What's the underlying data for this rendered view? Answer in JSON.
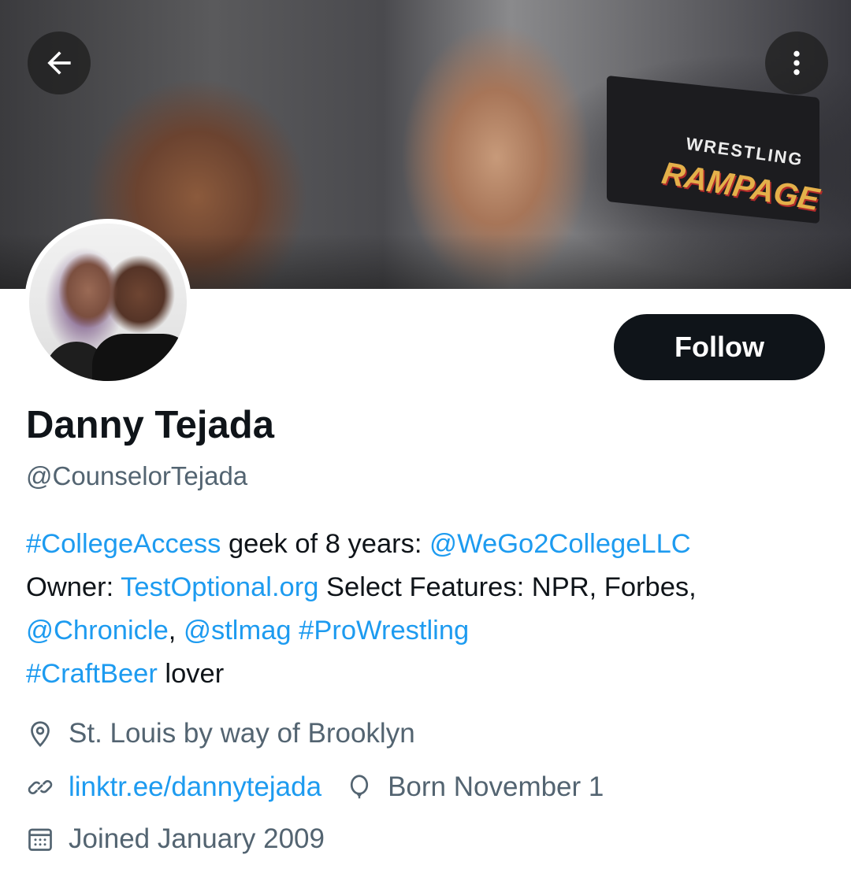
{
  "header": {
    "back_icon": "arrow-left-icon",
    "more_icon": "more-vertical-icon"
  },
  "banner": {
    "sign_line1": "WRESTLING",
    "sign_line2": "RAMPAGE"
  },
  "profile": {
    "display_name": "Danny Tejada",
    "handle": "@CounselorTejada",
    "follow_label": "Follow"
  },
  "bio": {
    "hashtag_college_access": "#CollegeAccess",
    "text_1": " geek of 8 years: ",
    "mention_wego": "@WeGo2CollegeLLC",
    "text_owner": "Owner: ",
    "link_testoptional": "TestOptional.org",
    "text_features": " Select Features: NPR, Forbes, ",
    "mention_chronicle": "@Chronicle",
    "text_comma": ", ",
    "mention_stlmag": "@stlmag",
    "text_space": " ",
    "hashtag_prowrestling": "#ProWrestling",
    "hashtag_craftbeer": "#CraftBeer",
    "text_lover": " lover"
  },
  "meta": {
    "location": "St. Louis by way of Brooklyn",
    "website": "linktr.ee/dannytejada",
    "born": "Born November 1",
    "joined": "Joined January 2009"
  },
  "colors": {
    "link": "#1d9bf0",
    "secondary_text": "#536471",
    "primary_text": "#0f1419",
    "follow_button_bg": "#0f1419"
  }
}
